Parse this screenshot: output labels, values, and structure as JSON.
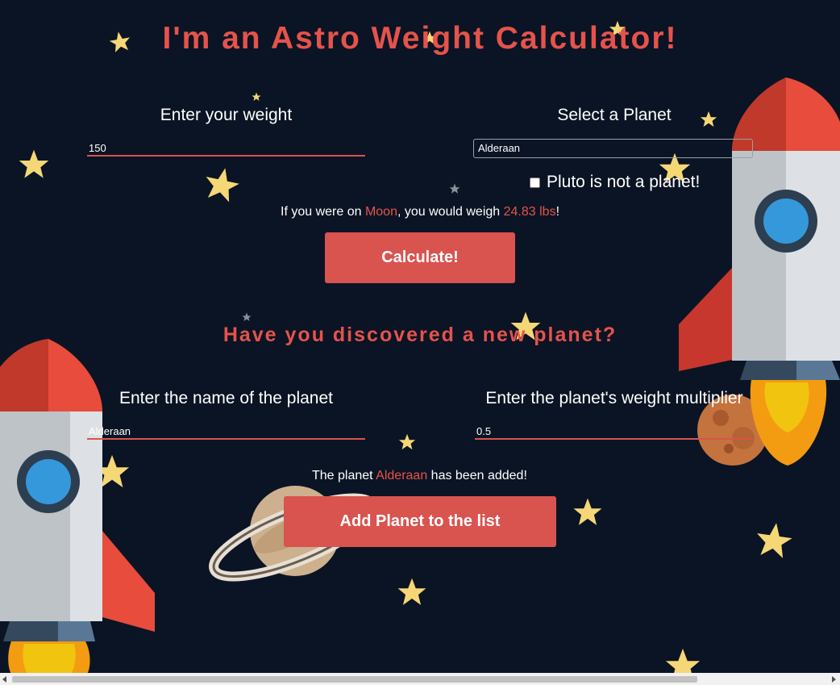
{
  "title": "I'm an Astro Weight Calculator!",
  "weight_form": {
    "weight_label": "Enter your weight",
    "weight_value": "150",
    "planet_label": "Select a Planet",
    "planet_selected": "Alderaan",
    "pluto_checkbox_label": "Pluto is not a planet!",
    "pluto_checked": false,
    "result": {
      "prefix": "If you were on ",
      "planet": "Moon",
      "middle": ", you would weigh ",
      "weight": "24.83 lbs",
      "suffix": "!"
    },
    "calculate_label": "Calculate!"
  },
  "new_planet": {
    "heading": "Have you discovered a new planet?",
    "name_label": "Enter the name of the planet",
    "name_value": "Alderaan",
    "multiplier_label": "Enter the planet's weight multiplier",
    "multiplier_value": "0.5",
    "added": {
      "prefix": "The planet ",
      "planet": "Alderaan",
      "suffix": " has been added!"
    },
    "add_label": "Add Planet to the list"
  },
  "colors": {
    "background": "#0b1424",
    "accent": "#d9534f",
    "star": "#f6d776"
  },
  "decorations": [
    "rocket-icon",
    "saturn-icon",
    "mars-icon",
    "star-icon"
  ]
}
